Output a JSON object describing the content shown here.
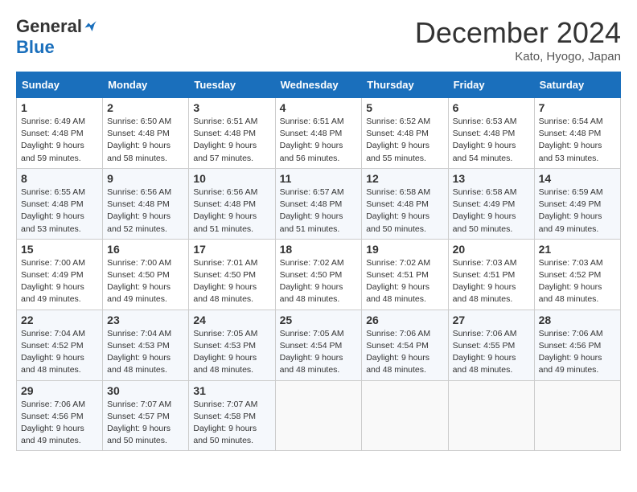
{
  "header": {
    "logo_general": "General",
    "logo_blue": "Blue",
    "month_title": "December 2024",
    "subtitle": "Kato, Hyogo, Japan"
  },
  "days_of_week": [
    "Sunday",
    "Monday",
    "Tuesday",
    "Wednesday",
    "Thursday",
    "Friday",
    "Saturday"
  ],
  "weeks": [
    [
      {
        "day": 1,
        "sunrise": "6:49 AM",
        "sunset": "4:48 PM",
        "daylight": "9 hours and 59 minutes."
      },
      {
        "day": 2,
        "sunrise": "6:50 AM",
        "sunset": "4:48 PM",
        "daylight": "9 hours and 58 minutes."
      },
      {
        "day": 3,
        "sunrise": "6:51 AM",
        "sunset": "4:48 PM",
        "daylight": "9 hours and 57 minutes."
      },
      {
        "day": 4,
        "sunrise": "6:51 AM",
        "sunset": "4:48 PM",
        "daylight": "9 hours and 56 minutes."
      },
      {
        "day": 5,
        "sunrise": "6:52 AM",
        "sunset": "4:48 PM",
        "daylight": "9 hours and 55 minutes."
      },
      {
        "day": 6,
        "sunrise": "6:53 AM",
        "sunset": "4:48 PM",
        "daylight": "9 hours and 54 minutes."
      },
      {
        "day": 7,
        "sunrise": "6:54 AM",
        "sunset": "4:48 PM",
        "daylight": "9 hours and 53 minutes."
      }
    ],
    [
      {
        "day": 8,
        "sunrise": "6:55 AM",
        "sunset": "4:48 PM",
        "daylight": "9 hours and 53 minutes."
      },
      {
        "day": 9,
        "sunrise": "6:56 AM",
        "sunset": "4:48 PM",
        "daylight": "9 hours and 52 minutes."
      },
      {
        "day": 10,
        "sunrise": "6:56 AM",
        "sunset": "4:48 PM",
        "daylight": "9 hours and 51 minutes."
      },
      {
        "day": 11,
        "sunrise": "6:57 AM",
        "sunset": "4:48 PM",
        "daylight": "9 hours and 51 minutes."
      },
      {
        "day": 12,
        "sunrise": "6:58 AM",
        "sunset": "4:48 PM",
        "daylight": "9 hours and 50 minutes."
      },
      {
        "day": 13,
        "sunrise": "6:58 AM",
        "sunset": "4:49 PM",
        "daylight": "9 hours and 50 minutes."
      },
      {
        "day": 14,
        "sunrise": "6:59 AM",
        "sunset": "4:49 PM",
        "daylight": "9 hours and 49 minutes."
      }
    ],
    [
      {
        "day": 15,
        "sunrise": "7:00 AM",
        "sunset": "4:49 PM",
        "daylight": "9 hours and 49 minutes."
      },
      {
        "day": 16,
        "sunrise": "7:00 AM",
        "sunset": "4:50 PM",
        "daylight": "9 hours and 49 minutes."
      },
      {
        "day": 17,
        "sunrise": "7:01 AM",
        "sunset": "4:50 PM",
        "daylight": "9 hours and 48 minutes."
      },
      {
        "day": 18,
        "sunrise": "7:02 AM",
        "sunset": "4:50 PM",
        "daylight": "9 hours and 48 minutes."
      },
      {
        "day": 19,
        "sunrise": "7:02 AM",
        "sunset": "4:51 PM",
        "daylight": "9 hours and 48 minutes."
      },
      {
        "day": 20,
        "sunrise": "7:03 AM",
        "sunset": "4:51 PM",
        "daylight": "9 hours and 48 minutes."
      },
      {
        "day": 21,
        "sunrise": "7:03 AM",
        "sunset": "4:52 PM",
        "daylight": "9 hours and 48 minutes."
      }
    ],
    [
      {
        "day": 22,
        "sunrise": "7:04 AM",
        "sunset": "4:52 PM",
        "daylight": "9 hours and 48 minutes."
      },
      {
        "day": 23,
        "sunrise": "7:04 AM",
        "sunset": "4:53 PM",
        "daylight": "9 hours and 48 minutes."
      },
      {
        "day": 24,
        "sunrise": "7:05 AM",
        "sunset": "4:53 PM",
        "daylight": "9 hours and 48 minutes."
      },
      {
        "day": 25,
        "sunrise": "7:05 AM",
        "sunset": "4:54 PM",
        "daylight": "9 hours and 48 minutes."
      },
      {
        "day": 26,
        "sunrise": "7:06 AM",
        "sunset": "4:54 PM",
        "daylight": "9 hours and 48 minutes."
      },
      {
        "day": 27,
        "sunrise": "7:06 AM",
        "sunset": "4:55 PM",
        "daylight": "9 hours and 48 minutes."
      },
      {
        "day": 28,
        "sunrise": "7:06 AM",
        "sunset": "4:56 PM",
        "daylight": "9 hours and 49 minutes."
      }
    ],
    [
      {
        "day": 29,
        "sunrise": "7:06 AM",
        "sunset": "4:56 PM",
        "daylight": "9 hours and 49 minutes."
      },
      {
        "day": 30,
        "sunrise": "7:07 AM",
        "sunset": "4:57 PM",
        "daylight": "9 hours and 50 minutes."
      },
      {
        "day": 31,
        "sunrise": "7:07 AM",
        "sunset": "4:58 PM",
        "daylight": "9 hours and 50 minutes."
      },
      null,
      null,
      null,
      null
    ]
  ]
}
